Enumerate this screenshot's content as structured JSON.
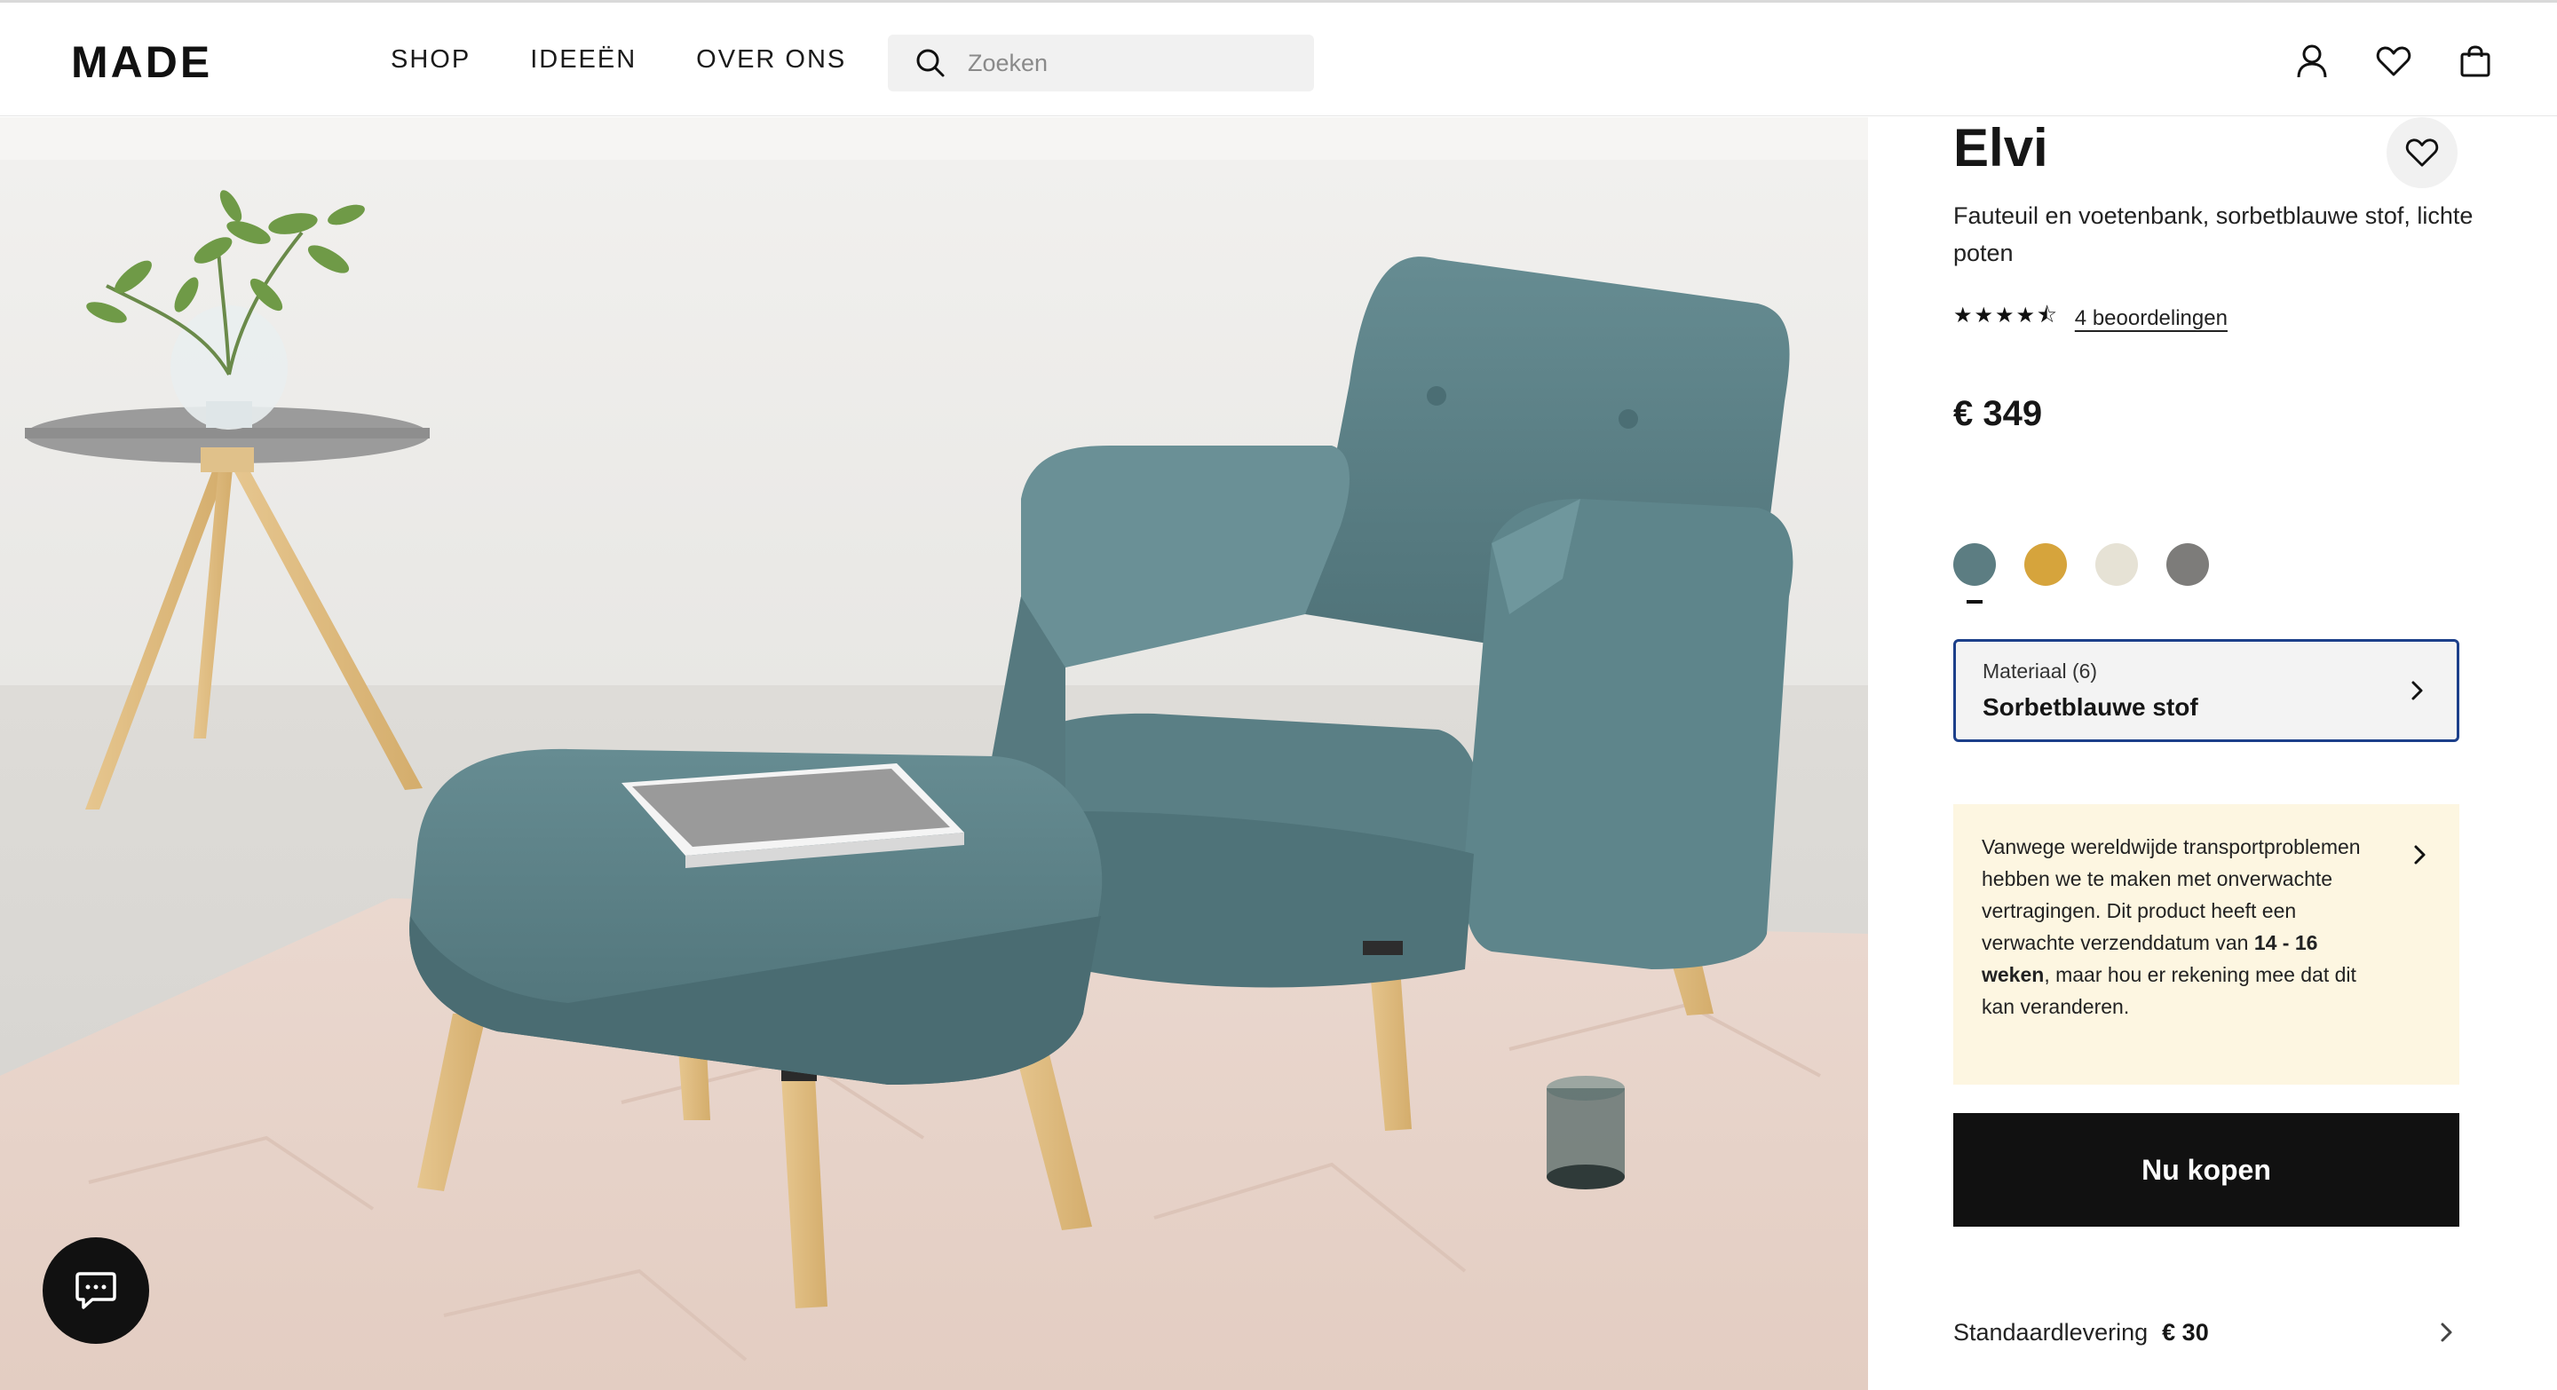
{
  "header": {
    "logo": "MADE",
    "nav": [
      "SHOP",
      "IDEEËN",
      "OVER ONS"
    ],
    "search_placeholder": "Zoeken",
    "icons": [
      "user-icon",
      "heart-icon",
      "shopping-bag-icon"
    ]
  },
  "product": {
    "name": "Elvi",
    "description": "Fauteuil en voetenbank, sorbetblauwe stof, lichte poten",
    "rating": 4.5,
    "stars": "★★★★⯪",
    "reviews_label": "4 beoordelingen",
    "price": "€ 349",
    "swatches": [
      {
        "color": "#5c7d82",
        "selected": true
      },
      {
        "color": "#d6a43c",
        "selected": false
      },
      {
        "color": "#e6e2d5",
        "selected": false
      },
      {
        "color": "#7d7c7a",
        "selected": false
      }
    ],
    "material_label": "Materiaal (6)",
    "material_value": "Sorbetblauwe stof",
    "notice": {
      "before": "Vanwege wereldwijde transportproblemen hebben we te maken met onverwachte vertragingen. Dit product heeft een verwachte verzenddatum van ",
      "bold": "14 - 16 weken",
      "after": ", maar hou er rekening mee dat dit kan veranderen."
    },
    "buy_label": "Nu kopen",
    "delivery_label": "Standaardlevering",
    "delivery_price": "€ 30"
  },
  "colors": {
    "chair": "#5c8288",
    "notice_bg": "#fdf6e1",
    "material_border": "#1c3f8a",
    "buy_bg": "#111111"
  }
}
